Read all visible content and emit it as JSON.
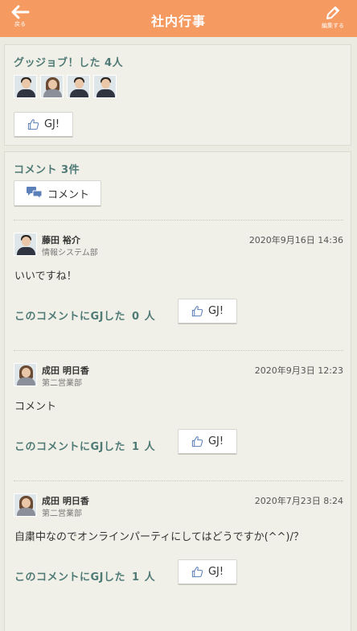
{
  "header": {
    "title": "社内行事",
    "back_label": "戻る",
    "edit_label": "編集する"
  },
  "gj_section": {
    "title": "グッジョブ！した 4人",
    "users": [
      "m",
      "f",
      "m",
      "m"
    ],
    "button_label": "GJ!"
  },
  "comments_section": {
    "title": "コメント 3件",
    "comment_button_label": "コメント",
    "comments": [
      {
        "name": "藤田 裕介",
        "dept": "情報システム部",
        "date": "2020年9月16日 14:36",
        "text": "いいですね！",
        "gj_prefix": "このコメントにGJした",
        "gj_count": "0",
        "gj_suffix": "人",
        "gj_button": "GJ!",
        "avatar": "m"
      },
      {
        "name": "成田 明日香",
        "dept": "第二営業部",
        "date": "2020年9月3日 12:23",
        "text": "コメント",
        "gj_prefix": "このコメントにGJした",
        "gj_count": "1",
        "gj_suffix": "人",
        "gj_button": "GJ!",
        "avatar": "f"
      },
      {
        "name": "成田 明日香",
        "dept": "第二営業部",
        "date": "2020年7月23日 8:24",
        "text": "自粛中なのでオンラインパーティにしてはどうですか(^^)/？",
        "gj_prefix": "このコメントにGJした",
        "gj_count": "1",
        "gj_suffix": "人",
        "gj_button": "GJ!",
        "avatar": "f"
      }
    ]
  },
  "colors": {
    "header": "#f59a61",
    "accent_text": "#4f7a76",
    "background": "#ecebe2"
  }
}
